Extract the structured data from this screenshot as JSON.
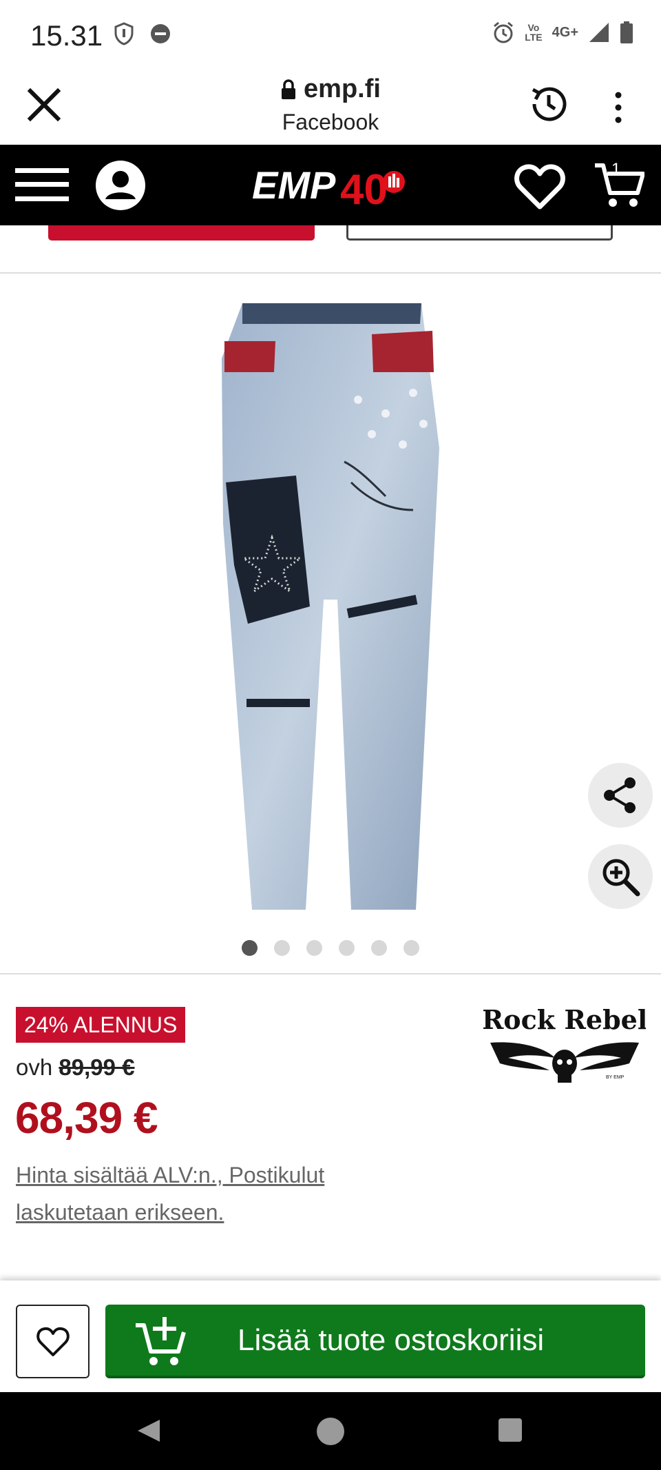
{
  "status_bar": {
    "time": "15.31",
    "network": "4G+",
    "volte_line1": "Vo",
    "volte_line2": "LTE"
  },
  "browser": {
    "url": "emp.fi",
    "subtitle": "Facebook"
  },
  "header": {
    "logo_text": "EMP",
    "logo_number": "40",
    "cart_count": "1"
  },
  "gallery": {
    "image_count": 6,
    "active_index": 0
  },
  "product": {
    "discount_badge": "24% ALENNUS",
    "old_price_prefix": "ovh",
    "old_price": "89,99 €",
    "price": "68,39 €",
    "tax_note": "Hinta sisältää ALV:n., Postikulut laskutetaan erikseen.",
    "brand_name": "Rock Rebel",
    "brand_tag": "BY EMP"
  },
  "actions": {
    "add_to_cart": "Lisää tuote ostoskoriisi"
  },
  "colors": {
    "header_bg": "#000000",
    "sale_red": "#c8102e",
    "price_red": "#b0101e",
    "cart_green": "#0f7a1c"
  }
}
